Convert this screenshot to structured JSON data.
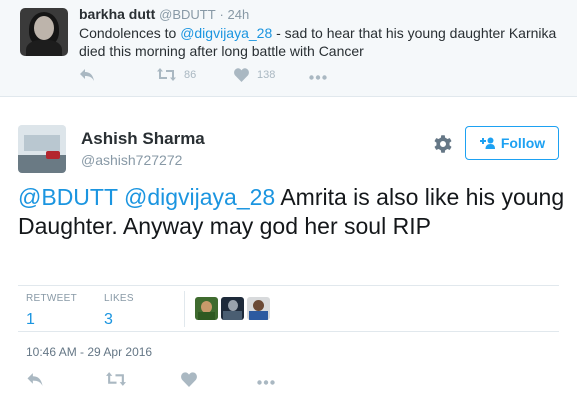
{
  "top_tweet": {
    "name": "barkha dutt",
    "handle": "@BDUTT",
    "time": "24h",
    "text_prefix": "Condolences to ",
    "mention": "@digvijaya_28",
    "text_suffix": " - sad to hear that his young daughter Karnika died this morning after long battle with Cancer",
    "retweets": "86",
    "likes": "138"
  },
  "main_tweet": {
    "name": "Ashish Sharma",
    "handle": "@ashish727272",
    "follow_label": "Follow",
    "mention1": "@BDUTT",
    "mention2": "@digvijaya_28",
    "text": " Amrita is also like his young Daughter. Anyway may god her soul RIP",
    "retweet_label": "RETWEET",
    "retweet_count": "1",
    "likes_label": "LIKES",
    "likes_count": "3",
    "timestamp": "10:46 AM - 29 Apr 2016"
  },
  "colors": {
    "accent": "#1da1f2",
    "link": "#1b95e0",
    "icon_gray": "#aab8c2"
  },
  "icons": [
    "reply-icon",
    "retweet-icon",
    "heart-icon",
    "more-icon",
    "gear-icon",
    "follow-user-icon"
  ]
}
